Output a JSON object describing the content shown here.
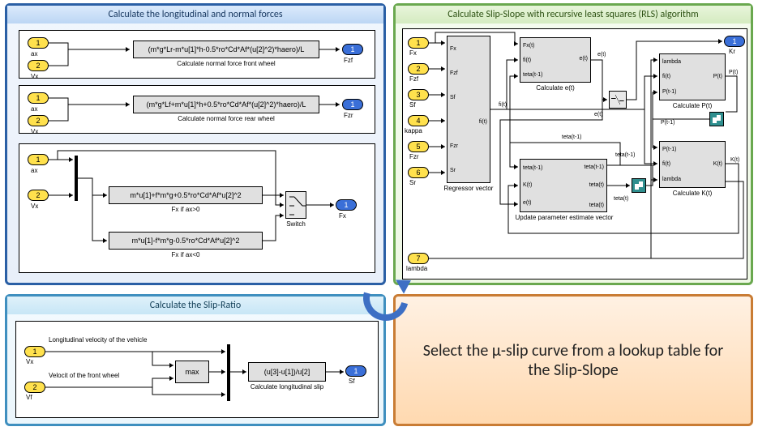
{
  "panel1": {
    "title": "Calculate the longitudinal  and normal forces",
    "box1": {
      "in1": {
        "num": "1",
        "label": "ax"
      },
      "in2": {
        "num": "2",
        "label": "Vx"
      },
      "expr": "(m*g*Lr-m*u[1]*h-0.5*ro*Cd*Af*(u[2]^2)*haero)/L",
      "caption": "Calculate normal force front wheel",
      "out": {
        "num": "1",
        "label": "Fzf"
      }
    },
    "box2": {
      "in1": {
        "num": "1",
        "label": "ax"
      },
      "in2": {
        "num": "2",
        "label": "Vx"
      },
      "expr": "(m*g*Lf+m*u[1]*h+0.5*ro*Cd*Af*(u[2]^2)*haero)/L",
      "caption": "Calculate normal force rear wheel",
      "out": {
        "num": "1",
        "label": "Fzr"
      }
    },
    "box3": {
      "in1": {
        "num": "1",
        "label": "ax"
      },
      "in2": {
        "num": "2",
        "label": "Vx"
      },
      "expr1": "m*u[1]+f*m*g+0.5*ro*Cd*Af*u[2]^2",
      "cap1": "Fx if ax>0",
      "expr2": "m*u[1]-f*m*g-0.5*ro*Cd*Af*u[2]^2",
      "cap2": "Fx if ax<0",
      "switch": "Switch",
      "out": {
        "num": "1",
        "label": "Fx"
      }
    }
  },
  "panel2": {
    "title": "Calculate Slip-Slope with recursive least squares (RLS) algorithm",
    "in": [
      {
        "num": "1",
        "label": "Fx"
      },
      {
        "num": "2",
        "label": "Fzf"
      },
      {
        "num": "3",
        "label": "Sf"
      },
      {
        "num": "4",
        "label": "kappa"
      },
      {
        "num": "5",
        "label": "Fzr"
      },
      {
        "num": "6",
        "label": "Sr"
      },
      {
        "num": "7",
        "label": "lambda"
      }
    ],
    "out": {
      "num": "1",
      "label": "Kr"
    },
    "regressor": {
      "name": "Regressor vector",
      "ports": [
        "Fx",
        "Fzf",
        "Sf",
        "fi(t)",
        "Fzr",
        "Sr"
      ],
      "out": "fi(t)"
    },
    "calc_e": {
      "name": "Calculate e(t)",
      "ports": [
        "Fx(t)",
        "fi(t)",
        "teta(t-1)"
      ],
      "out": "e(t)"
    },
    "update": {
      "name": "Update parameter estimate vector",
      "ports": [
        "teta(t-1)",
        "K(t)",
        "e(t)"
      ],
      "mid": "teta(t)",
      "out": "teta(t)"
    },
    "calc_p": {
      "name": "Calculate P(t)",
      "ports": [
        "lambda",
        "fi(t)",
        "P(t-1)"
      ],
      "out": "P(t)"
    },
    "calc_k": {
      "name": "Calculate K(t)",
      "ports": [
        "P(t-1)",
        "fi(t)",
        "lambda"
      ],
      "out": "K(t)"
    },
    "sig": {
      "e": "e(t)",
      "teta": "teta(t)",
      "tetam": "teta(t-1)",
      "P": "P(t)",
      "Pm": "P(t-1)",
      "K": "K(t)",
      "fi": "fi(t)"
    }
  },
  "panel3": {
    "title": "Calculate the Slip-Ratio",
    "in1": {
      "num": "1",
      "label": "Vx",
      "desc": "Longitudinal velocity of the vehicle"
    },
    "in2": {
      "num": "2",
      "label": "Vf",
      "desc": "Velocit of the front wheel"
    },
    "max": "max",
    "expr": "(u[3]-u[1])/u[2]",
    "caption": "Calculate longitudinal slip",
    "out": {
      "num": "1",
      "label": "Sf"
    }
  },
  "panel4": {
    "text": "Select the μ-slip curve from a lookup table for the Slip-Slope"
  }
}
